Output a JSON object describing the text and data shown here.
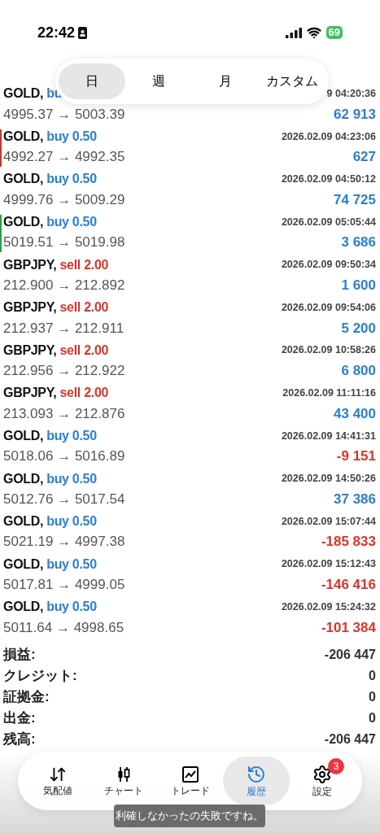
{
  "status_bar": {
    "time": "22:42",
    "battery": "69"
  },
  "period_tabs": [
    {
      "label": "日",
      "selected": true
    },
    {
      "label": "週",
      "selected": false
    },
    {
      "label": "月",
      "selected": false
    },
    {
      "label": "カスタム",
      "selected": false
    }
  ],
  "trades": [
    {
      "symbol": "GOLD,",
      "side": "bu",
      "kind": "buy",
      "time": "9 04:20:36",
      "prices": "4995.37 → 5003.39",
      "profit": "62 913",
      "loss": false
    },
    {
      "symbol": "GOLD,",
      "side": "buy 0.50",
      "kind": "buy",
      "time": "2026.02.09 04:23:06",
      "prices": "4992.27 → 4992.35",
      "profit": "627",
      "loss": false,
      "color": "#c0392b"
    },
    {
      "symbol": "GOLD,",
      "side": "buy 0.50",
      "kind": "buy",
      "time": "2026.02.09 04:50:12",
      "prices": "4999.76 → 5009.29",
      "profit": "74 725",
      "loss": false
    },
    {
      "symbol": "GOLD,",
      "side": "buy 0.50",
      "kind": "buy",
      "time": "2026.02.09 05:05:44",
      "prices": "5019.51 → 5019.98",
      "profit": "3 686",
      "loss": false,
      "color": "#2e9e4a"
    },
    {
      "symbol": "GBPJPY,",
      "side": "sell 2.00",
      "kind": "sell",
      "time": "2026.02.09 09:50:34",
      "prices": "212.900 → 212.892",
      "profit": "1 600",
      "loss": false
    },
    {
      "symbol": "GBPJPY,",
      "side": "sell 2.00",
      "kind": "sell",
      "time": "2026.02.09 09:54:06",
      "prices": "212.937 → 212.911",
      "profit": "5 200",
      "loss": false
    },
    {
      "symbol": "GBPJPY,",
      "side": "sell 2.00",
      "kind": "sell",
      "time": "2026.02.09 10:58:26",
      "prices": "212.956 → 212.922",
      "profit": "6 800",
      "loss": false
    },
    {
      "symbol": "GBPJPY,",
      "side": "sell 2.00",
      "kind": "sell",
      "time": "2026.02.09 11:11:16",
      "prices": "213.093 → 212.876",
      "profit": "43 400",
      "loss": false
    },
    {
      "symbol": "GOLD,",
      "side": "buy 0.50",
      "kind": "buy",
      "time": "2026.02.09 14:41:31",
      "prices": "5018.06 → 5016.89",
      "profit": "-9 151",
      "loss": true
    },
    {
      "symbol": "GOLD,",
      "side": "buy 0.50",
      "kind": "buy",
      "time": "2026.02.09 14:50:26",
      "prices": "5012.76 → 5017.54",
      "profit": "37 386",
      "loss": false
    },
    {
      "symbol": "GOLD,",
      "side": "buy 0.50",
      "kind": "buy",
      "time": "2026.02.09 15:07:44",
      "prices": "5021.19 → 4997.38",
      "profit": "-185 833",
      "loss": true
    },
    {
      "symbol": "GOLD,",
      "side": "buy 0.50",
      "kind": "buy",
      "time": "2026.02.09 15:12:43",
      "prices": "5017.81 → 4999.05",
      "profit": "-146 416",
      "loss": true
    },
    {
      "symbol": "GOLD,",
      "side": "buy 0.50",
      "kind": "buy",
      "time": "2026.02.09 15:24:32",
      "prices": "5011.64 → 4998.65",
      "profit": "-101 384",
      "loss": true
    }
  ],
  "summary": [
    {
      "label": "損益:",
      "value": "-206 447"
    },
    {
      "label": "クレジット:",
      "value": "0"
    },
    {
      "label": "証拠金:",
      "value": "0"
    },
    {
      "label": "出金:",
      "value": "0"
    },
    {
      "label": "残高:",
      "value": "-206 447"
    }
  ],
  "tab_bar": [
    {
      "kind": "quotes",
      "label": "気配値",
      "selected": false
    },
    {
      "kind": "chart",
      "label": "チャート",
      "selected": false
    },
    {
      "kind": "trade",
      "label": "トレード",
      "selected": false
    },
    {
      "kind": "history",
      "label": "履歴",
      "selected": true
    },
    {
      "kind": "settings",
      "label": "設定",
      "selected": false,
      "badge": "3"
    }
  ],
  "toast": "利確しなかったの失敗ですね。"
}
